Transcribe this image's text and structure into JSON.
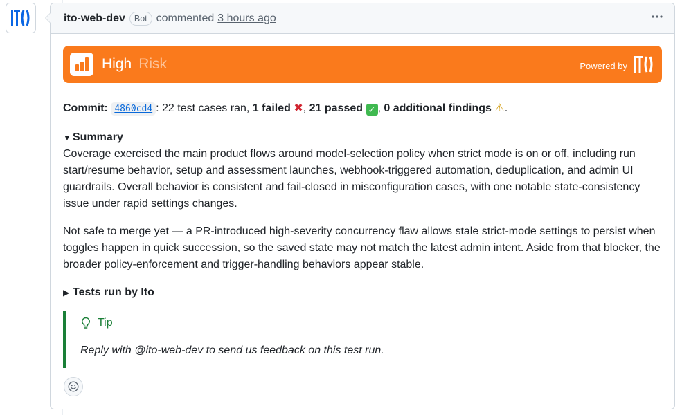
{
  "header": {
    "author": "ito-web-dev",
    "badge": "Bot",
    "action": "commented",
    "time": "3 hours ago",
    "menu_icon": "kebab-horizontal-icon"
  },
  "banner": {
    "risk_level": "High",
    "risk_label": "Risk",
    "powered_by": "Powered by",
    "logo_text": "IT()",
    "color": "#fa7a1c"
  },
  "commit": {
    "label": "Commit:",
    "sha": "4860cd4",
    "ran_text": ": 22 test cases ran, ",
    "failed": "1 failed",
    "sep1": ", ",
    "passed": "21 passed",
    "sep2": ", ",
    "findings": "0 additional findings",
    "end": "."
  },
  "summary": {
    "title": "Summary",
    "paragraphs": [
      "Coverage exercised the main product flows around model-selection policy when strict mode is on or off, including run start/resume behavior, setup and assessment launches, webhook-triggered automation, deduplication, and admin UI guardrails. Overall behavior is consistent and fail-closed in misconfiguration cases, with one notable state-consistency issue under rapid settings changes.",
      "Not safe to merge yet — a PR-introduced high-severity concurrency flaw allows stale strict-mode settings to persist when toggles happen in quick succession, so the saved state may not match the latest admin intent. Aside from that blocker, the broader policy-enforcement and trigger-handling behaviors appear stable."
    ]
  },
  "tests": {
    "title": "Tests run by Ito"
  },
  "tip": {
    "title": "Tip",
    "body": "Reply with @ito-web-dev to send us feedback on this test run."
  },
  "colors": {
    "accent": "#fa7a1c",
    "link": "#0969da",
    "success": "#1a7f37",
    "danger": "#d1242f"
  }
}
